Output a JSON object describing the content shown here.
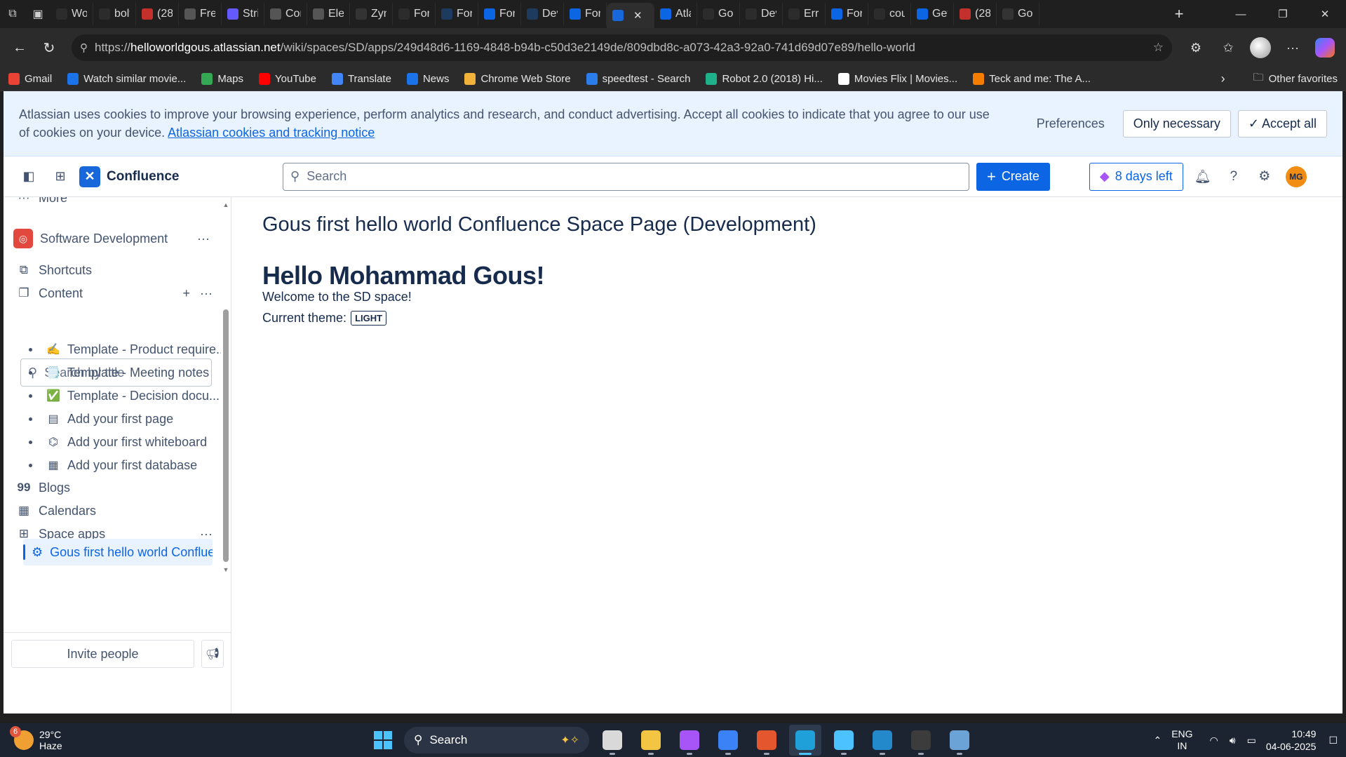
{
  "browser": {
    "tabs": [
      {
        "title": "Wo",
        "icon": "d-icon",
        "color": "#2c2c2c"
      },
      {
        "title": "bolt",
        "icon": "bolt-icon",
        "color": "#2c2c2c"
      },
      {
        "title": "(28",
        "icon": "youtube-icon",
        "color": "#c4302b"
      },
      {
        "title": "Free",
        "icon": "pause-icon",
        "color": "#555555"
      },
      {
        "title": "Strip",
        "icon": "s-icon",
        "color": "#635bff"
      },
      {
        "title": "Con",
        "icon": "pause-icon",
        "color": "#555555"
      },
      {
        "title": "Elev",
        "icon": "pause-icon",
        "color": "#555555"
      },
      {
        "title": "Zyn",
        "icon": "github-icon",
        "color": "#333333"
      },
      {
        "title": "Forg",
        "icon": "d-icon",
        "color": "#2c2c2c"
      },
      {
        "title": "Forg",
        "icon": "d-icon",
        "color": "#1f3a5f"
      },
      {
        "title": "Forg",
        "icon": "atlassian-icon",
        "color": "#0c66e4"
      },
      {
        "title": "Dev",
        "icon": "d-icon",
        "color": "#1f3a5f"
      },
      {
        "title": "Forg",
        "icon": "atlassian-icon",
        "color": "#0c66e4"
      },
      {
        "title": "",
        "icon": "confluence-icon",
        "color": "#1868db",
        "active": true
      },
      {
        "title": "Atla",
        "icon": "atlassian-icon",
        "color": "#0c66e4"
      },
      {
        "title": "Goo",
        "icon": "d-icon",
        "color": "#2c2c2c"
      },
      {
        "title": "Dev",
        "icon": "d-icon",
        "color": "#2c2c2c"
      },
      {
        "title": "Erro",
        "icon": "search-icon",
        "color": "#2c2c2c"
      },
      {
        "title": "Forg",
        "icon": "atlassian-icon",
        "color": "#0c66e4"
      },
      {
        "title": "cou",
        "icon": "search-icon",
        "color": "#2c2c2c"
      },
      {
        "title": "Get",
        "icon": "atlassian-icon",
        "color": "#0c66e4"
      },
      {
        "title": "(28",
        "icon": "youtube-icon",
        "color": "#c4302b"
      },
      {
        "title": "Gou",
        "icon": "github-icon",
        "color": "#333333"
      }
    ],
    "url_prefix": "https://",
    "url_host": "helloworldgous.atlassian.net",
    "url_path": "/wiki/spaces/SD/apps/249d48d6-1169-4848-b94b-c50d3e2149de/809dbd8c-a073-42a3-92a0-741d69d07e89/hello-world",
    "bookmarks": [
      {
        "label": "Gmail",
        "icon": "gmail-icon",
        "color": "#ea4335"
      },
      {
        "label": "Watch similar movie...",
        "icon": "play-icon",
        "color": "#1a73e8"
      },
      {
        "label": "Maps",
        "icon": "maps-icon",
        "color": "#34a853"
      },
      {
        "label": "YouTube",
        "icon": "youtube-icon",
        "color": "#ff0000"
      },
      {
        "label": "Translate",
        "icon": "translate-icon",
        "color": "#4285f4"
      },
      {
        "label": "News",
        "icon": "news-icon",
        "color": "#1a73e8"
      },
      {
        "label": "Chrome Web Store",
        "icon": "webstore-icon",
        "color": "#f1b23c"
      },
      {
        "label": "speedtest - Search",
        "icon": "bing-icon",
        "color": "#2b7de9"
      },
      {
        "label": "Robot 2.0 (2018) Hi...",
        "icon": "shield-icon",
        "color": "#1fb28a"
      },
      {
        "label": "Movies Flix | Movies...",
        "icon": "page-icon",
        "color": "#ffffff"
      },
      {
        "label": "Teck and me: The A...",
        "icon": "blogger-icon",
        "color": "#f57d00"
      }
    ],
    "other_favorites": "Other favorites"
  },
  "cookie_banner": {
    "text": "Atlassian uses cookies to improve your browsing experience, perform analytics and research, and conduct advertising. Accept all cookies to indicate that you agree to our use of cookies on your device.",
    "link": "Atlassian cookies and tracking notice",
    "preferences": "Preferences",
    "only_necessary": "Only necessary",
    "accept_all": "Accept all"
  },
  "topnav": {
    "product": "Confluence",
    "search_placeholder": "Search",
    "create": "Create",
    "trial": "8 days left",
    "user_initials": "MG"
  },
  "sidebar": {
    "more": "More",
    "space_name": "Software Development",
    "shortcuts": "Shortcuts",
    "content": "Content",
    "search_placeholder": "Search by title",
    "tree": [
      {
        "emoji": "✍️",
        "label": "Template - Product require..."
      },
      {
        "emoji": "🗒️",
        "label": "Template - Meeting notes"
      },
      {
        "emoji": "✅",
        "label": "Template - Decision docu..."
      },
      {
        "emoji": "▤",
        "label": "Add your first page"
      },
      {
        "emoji": "⌬",
        "label": "Add your first whiteboard"
      },
      {
        "emoji": "▦",
        "label": "Add your first database"
      }
    ],
    "blogs": "Blogs",
    "calendars": "Calendars",
    "space_apps": "Space apps",
    "active_app": "Gous first hello world Confluenc...",
    "invite": "Invite people"
  },
  "main": {
    "page_title": "Gous first hello world Confluence Space Page (Development)",
    "heading": "Hello Mohammad Gous!",
    "welcome": "Welcome to the SD space!",
    "theme_label": "Current theme:",
    "theme_value": "LIGHT"
  },
  "taskbar": {
    "weather_badge": "6",
    "temperature": "29°C",
    "condition": "Haze",
    "search": "Search",
    "lang1": "ENG",
    "lang2": "IN",
    "time": "10:49",
    "date": "04-06-2025",
    "apps": [
      {
        "name": "task-view-app",
        "color": "#d9d9d9"
      },
      {
        "name": "file-explorer-app",
        "color": "#f4c542"
      },
      {
        "name": "copilot-app",
        "color": "#a855f7"
      },
      {
        "name": "store-app",
        "color": "#3b82f6"
      },
      {
        "name": "office-app",
        "color": "#e4572e"
      },
      {
        "name": "edge-app",
        "color": "#1fa0d8",
        "active": true
      },
      {
        "name": "notepad-app",
        "color": "#4cc2ff"
      },
      {
        "name": "vscode-app",
        "color": "#2489ca"
      },
      {
        "name": "terminal-app",
        "color": "#3c3c3c"
      },
      {
        "name": "monitor-app",
        "color": "#6ba3d6"
      }
    ]
  }
}
